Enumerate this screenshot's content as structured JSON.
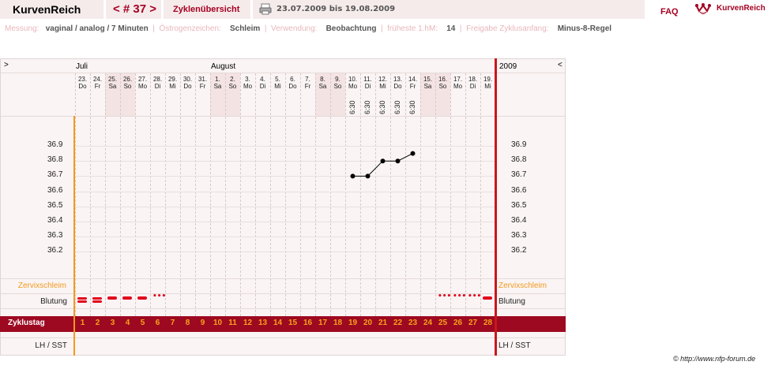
{
  "header": {
    "brand": "KurvenReich",
    "cycle_nav": "< # 37 >",
    "overview_tab": "Zyklenübersicht",
    "date_range": "23.07.2009 bis 19.08.2009",
    "faq": "FAQ",
    "logo_text": "KurvenReich",
    "print_icon": "printer-icon",
    "logo_icon": "crown-heart-icon"
  },
  "info": {
    "messung_label": "Messung:",
    "messung_value": "vaginal / analog / 7 Minuten",
    "oestrogen_label": "Östrogenzeichen:",
    "oestrogen_value": "Schleim",
    "verwendung_label": "Verwendung:",
    "verwendung_value": "Beobachtung",
    "fruehste_label": "früheste 1.hM:",
    "fruehste_value": "14",
    "freigabe_label": "Freigabe Zyklusanfang:",
    "freigabe_value": "Minus-8-Regel"
  },
  "chart": {
    "nav_left": ">",
    "nav_right": "<",
    "year": "2009",
    "month1": "Juli",
    "month2": "August",
    "row_zervix": "Zervixschleim",
    "row_blutung": "Blutung",
    "row_zyklustag": "Zyklustag",
    "row_lh": "LH / SST",
    "colors": {
      "accent": "#a50021",
      "cycle_bar": "#9d0921",
      "cycle_text": "#f7a21b",
      "orange_line": "#f39a1e",
      "red_line": "#c8161d"
    }
  },
  "chart_data": {
    "type": "line",
    "days": [
      {
        "date": "23.",
        "wd": "Do"
      },
      {
        "date": "24.",
        "wd": "Fr"
      },
      {
        "date": "25.",
        "wd": "Sa"
      },
      {
        "date": "26.",
        "wd": "So"
      },
      {
        "date": "27.",
        "wd": "Mo"
      },
      {
        "date": "28.",
        "wd": "Di"
      },
      {
        "date": "29.",
        "wd": "Mi"
      },
      {
        "date": "30.",
        "wd": "Do"
      },
      {
        "date": "31.",
        "wd": "Fr"
      },
      {
        "date": "1.",
        "wd": "Sa"
      },
      {
        "date": "2.",
        "wd": "So"
      },
      {
        "date": "3.",
        "wd": "Mo"
      },
      {
        "date": "4.",
        "wd": "Di"
      },
      {
        "date": "5.",
        "wd": "Mi"
      },
      {
        "date": "6.",
        "wd": "Do"
      },
      {
        "date": "7.",
        "wd": "Fr"
      },
      {
        "date": "8.",
        "wd": "Sa"
      },
      {
        "date": "9.",
        "wd": "So"
      },
      {
        "date": "10.",
        "wd": "Mo"
      },
      {
        "date": "11.",
        "wd": "Di"
      },
      {
        "date": "12.",
        "wd": "Mi"
      },
      {
        "date": "13.",
        "wd": "Do"
      },
      {
        "date": "14.",
        "wd": "Fr"
      },
      {
        "date": "15.",
        "wd": "Sa"
      },
      {
        "date": "16.",
        "wd": "So"
      },
      {
        "date": "17.",
        "wd": "Mo"
      },
      {
        "date": "18.",
        "wd": "Di"
      },
      {
        "date": "19.",
        "wd": "Mi"
      }
    ],
    "times": [
      "",
      "",
      "",
      "",
      "",
      "",
      "",
      "",
      "",
      "",
      "",
      "",
      "",
      "",
      "",
      "",
      "",
      "",
      "6:30",
      "6:30",
      "6:30",
      "6:30",
      "6:30",
      "",
      "",
      "",
      "",
      ""
    ],
    "temperatures": [
      null,
      null,
      null,
      null,
      null,
      null,
      null,
      null,
      null,
      null,
      null,
      null,
      null,
      null,
      null,
      null,
      null,
      null,
      36.7,
      36.7,
      36.8,
      36.8,
      36.85,
      null,
      null,
      null,
      null,
      null
    ],
    "y_ticks": [
      "36.9",
      "36.8",
      "36.7",
      "36.6",
      "36.5",
      "36.4",
      "36.3",
      "36.2"
    ],
    "ylim": [
      36.2,
      36.9
    ],
    "bleeding": [
      "heavy",
      "heavy",
      "medium",
      "medium",
      "medium",
      "spotting",
      "",
      "",
      "",
      "",
      "",
      "",
      "",
      "",
      "",
      "",
      "",
      "",
      "",
      "",
      "",
      "",
      "",
      "",
      "spotting",
      "spotting",
      "spotting",
      "medium"
    ],
    "cycle_days": [
      "1",
      "2",
      "3",
      "4",
      "5",
      "6",
      "7",
      "8",
      "9",
      "10",
      "11",
      "12",
      "13",
      "14",
      "15",
      "16",
      "17",
      "18",
      "19",
      "20",
      "21",
      "22",
      "23",
      "24",
      "25",
      "26",
      "27",
      "28"
    ]
  },
  "footer": {
    "copyright": "© http://www.nfp-forum.de"
  }
}
